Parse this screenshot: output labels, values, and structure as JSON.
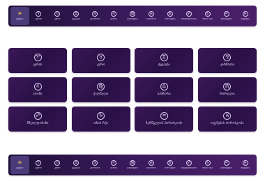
{
  "nav_items": [
    {
      "label": "ყველა",
      "glyph": "☀",
      "icon": "sun-icon"
    },
    {
      "label": "ვერძი",
      "glyph": "♈",
      "icon": "aries-icon"
    },
    {
      "label": "კურო",
      "glyph": "♉",
      "icon": "taurus-icon"
    },
    {
      "label": "ტყუპები",
      "glyph": "♊",
      "icon": "gemini-icon"
    },
    {
      "label": "კირჩხიბი",
      "glyph": "♋",
      "icon": "cancer-icon"
    },
    {
      "label": "ლომი",
      "glyph": "♌",
      "icon": "leo-icon"
    },
    {
      "label": "ქალწული",
      "glyph": "♍",
      "icon": "virgo-icon"
    },
    {
      "label": "სასწორი",
      "glyph": "♎",
      "icon": "libra-icon"
    },
    {
      "label": "მორიელი",
      "glyph": "♏",
      "icon": "scorpio-icon"
    },
    {
      "label": "მშვილდოსანი",
      "glyph": "♐",
      "icon": "sagittarius-icon"
    },
    {
      "label": "თხის რქა",
      "glyph": "♑",
      "icon": "capricorn-icon"
    },
    {
      "label": "მერწყული",
      "glyph": "♒",
      "icon": "aquarius-icon"
    },
    {
      "label": "თევზები",
      "glyph": "♓",
      "icon": "pisces-icon"
    }
  ],
  "cards": [
    {
      "label": "ვერძი",
      "glyph": "♈",
      "icon": "aries-icon"
    },
    {
      "label": "კურო",
      "glyph": "♉",
      "icon": "taurus-icon"
    },
    {
      "label": "ტყუპები",
      "glyph": "♊",
      "icon": "gemini-icon"
    },
    {
      "label": "კირჩხიბი",
      "glyph": "♋",
      "icon": "cancer-icon"
    },
    {
      "label": "ლომი",
      "glyph": "♌",
      "icon": "leo-icon"
    },
    {
      "label": "ქალწული",
      "glyph": "♍",
      "icon": "virgo-icon"
    },
    {
      "label": "სასწორი",
      "glyph": "♎",
      "icon": "libra-icon"
    },
    {
      "label": "მორიელი",
      "glyph": "♏",
      "icon": "scorpio-icon"
    },
    {
      "label": "მშვილდოსანი",
      "glyph": "♐",
      "icon": "sagittarius-icon"
    },
    {
      "label": "თხის რქა",
      "glyph": "♑",
      "icon": "capricorn-icon"
    },
    {
      "label": "მერწყულის ჰოროსკოპი",
      "glyph": "♒",
      "icon": "aquarius-icon"
    },
    {
      "label": "თევზების ჰოროსკოპი",
      "glyph": "♓",
      "icon": "pisces-icon"
    }
  ],
  "active_nav_index": 0,
  "colors": {
    "nav_bg": "#2b1446",
    "card_bg": "#2e1249",
    "active_item": "#4a3a78",
    "sun_icon": "#f7c948",
    "text": "#e6d8f5"
  }
}
